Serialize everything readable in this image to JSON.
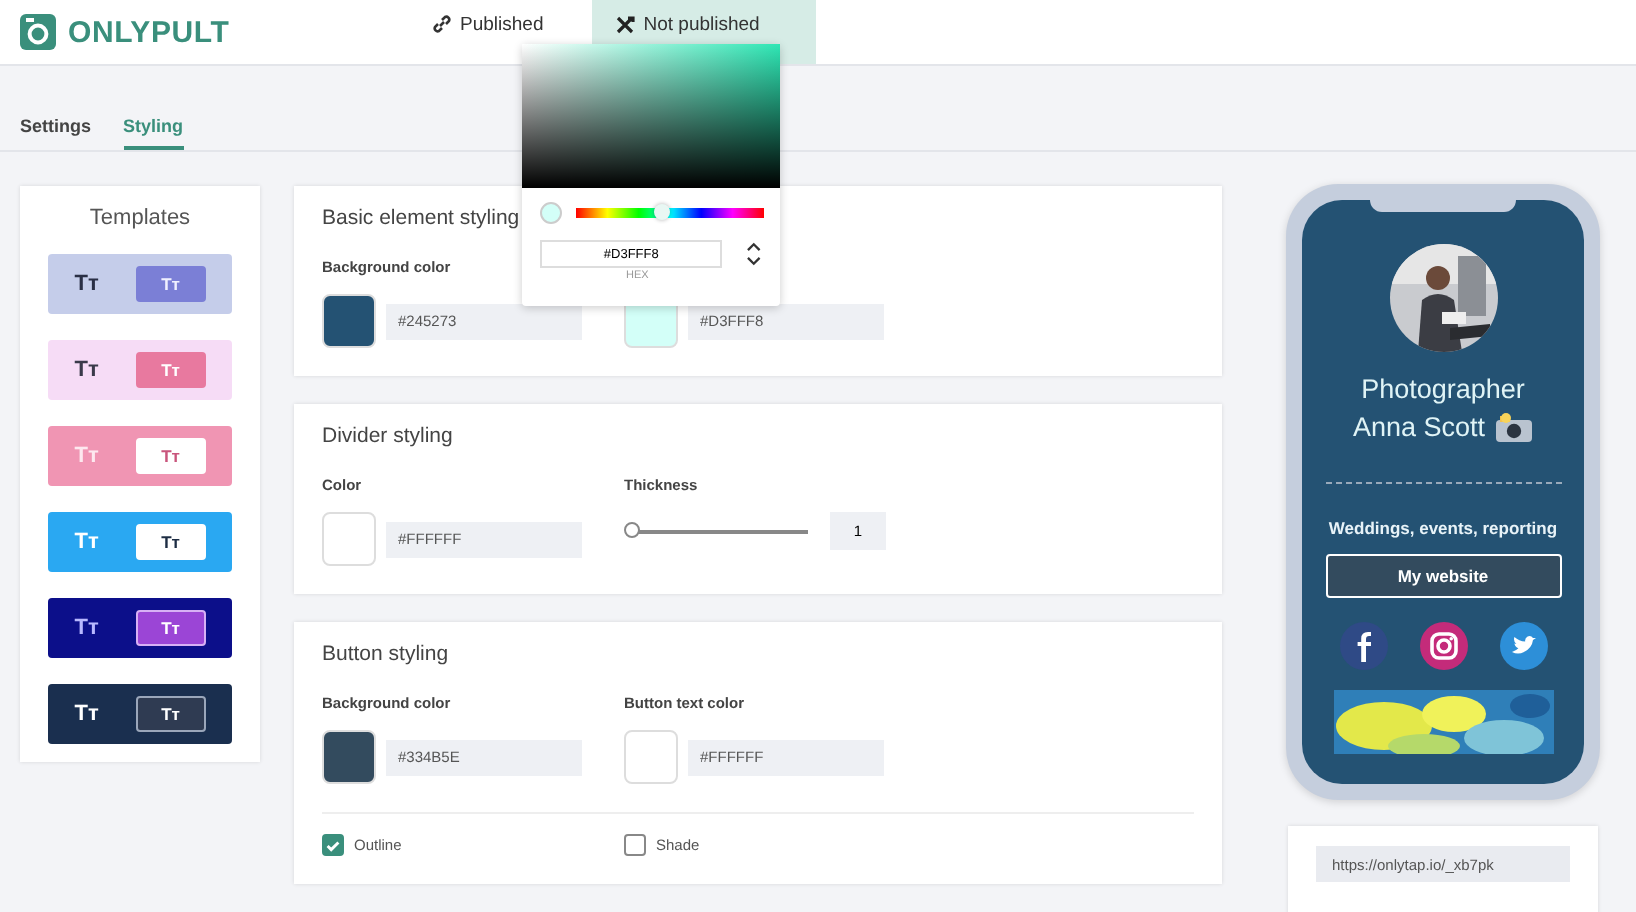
{
  "header": {
    "logo": "ONLYPULT",
    "publish_buttons": [
      {
        "label": "Published",
        "selected": false
      },
      {
        "label": "Not published",
        "selected": true
      }
    ]
  },
  "tabs": [
    {
      "label": "Settings",
      "selected": false
    },
    {
      "label": "Styling",
      "selected": true
    }
  ],
  "templates": {
    "title": "Templates",
    "items": [
      {
        "label": "Tт",
        "button_label": "Tт",
        "color": "#c5cdea"
      },
      {
        "label": "Tт",
        "button_label": "Tт",
        "color": "#f6dcf6"
      },
      {
        "label": "Tт",
        "button_label": "Tт",
        "color": "#f095b3"
      },
      {
        "label": "Tт",
        "button_label": "Tт",
        "color": "#2aa8f2"
      },
      {
        "label": "Tт",
        "button_label": "Tт",
        "color": "#0c0f8a"
      },
      {
        "label": "Tт",
        "button_label": "Tт",
        "color": "#1a2f4f"
      }
    ]
  },
  "sections": [
    {
      "title": "Basic element styling",
      "fields": [
        {
          "kind": "color",
          "label": "Background color",
          "color": "#245273",
          "value": "#245273"
        },
        {
          "kind": "color",
          "color": "#d3fff8",
          "value": "#D3FFF8"
        }
      ]
    },
    {
      "title": "Divider styling",
      "fields": [
        {
          "kind": "color",
          "label": "Color",
          "color": "#ffffff",
          "value": "#FFFFFF"
        },
        {
          "kind": "slider",
          "label": "Thickness",
          "level": 0,
          "value": "1"
        }
      ]
    },
    {
      "title": "Button styling",
      "fields": [
        {
          "kind": "color",
          "label": "Background color",
          "color": "#334b5e",
          "value": "#334B5E"
        },
        {
          "kind": "color",
          "label": "Button text color",
          "color": "#ffffff",
          "value": "#FFFFFF"
        }
      ],
      "options": [
        {
          "label": "Outline",
          "checked": true
        },
        {
          "label": "Shade",
          "checked": false
        }
      ]
    }
  ],
  "color_picker": {
    "level": 0.46,
    "color": "#d3fff8",
    "value": "#D3FFF8",
    "format": "HEX"
  },
  "preview": {
    "title_lines": [
      "Photographer",
      "Anna Scott"
    ],
    "subtitle": "Weddings, events, reporting",
    "button": "My website",
    "socials": [
      {
        "kind": "facebook"
      },
      {
        "kind": "instagram"
      },
      {
        "kind": "twitter"
      }
    ]
  },
  "link": {
    "url": "https://onlytap.io/_xb7pk"
  }
}
